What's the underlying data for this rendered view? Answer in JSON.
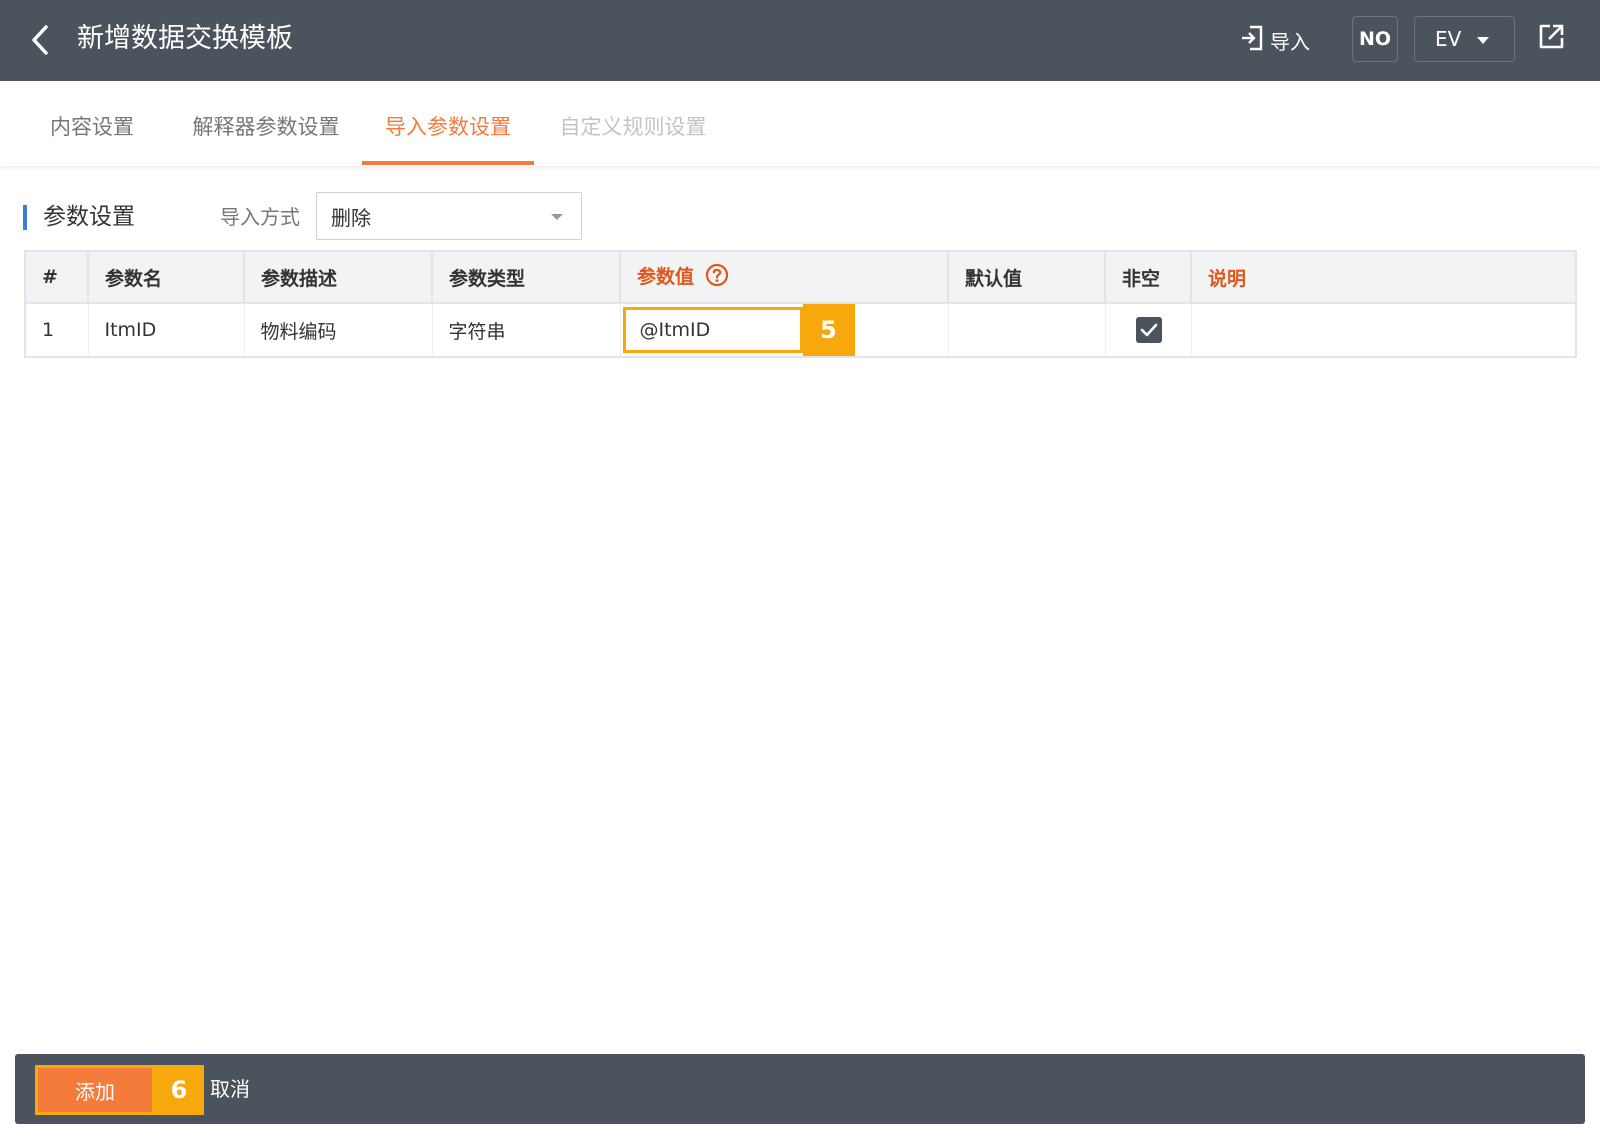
{
  "header": {
    "title": "新增数据交换模板",
    "import_label": "导入",
    "no_label": "NO",
    "language": "EV",
    "colors": {
      "bar": "#4b535c",
      "accent": "#f47b3b",
      "highlight": "#f7a80c"
    }
  },
  "tabs": [
    {
      "label": "内容设置",
      "state": "normal"
    },
    {
      "label": "解释器参数设置",
      "state": "normal"
    },
    {
      "label": "导入参数设置",
      "state": "active"
    },
    {
      "label": "自定义规则设置",
      "state": "disabled"
    }
  ],
  "section": {
    "title": "参数设置",
    "mode_label": "导入方式",
    "mode_value": "删除"
  },
  "table": {
    "headers": [
      "#",
      "参数名",
      "参数描述",
      "参数类型",
      "参数值",
      "默认值",
      "非空",
      "说明"
    ],
    "rows": [
      {
        "index": "1",
        "name": "ItmID",
        "description": "物料编码",
        "type": "字符串",
        "value": "@ItmID",
        "default": "",
        "required": true,
        "note": ""
      }
    ]
  },
  "annotations": {
    "step5": "5",
    "step6": "6"
  },
  "footer": {
    "add_label": "添加",
    "cancel_label": "取消"
  }
}
